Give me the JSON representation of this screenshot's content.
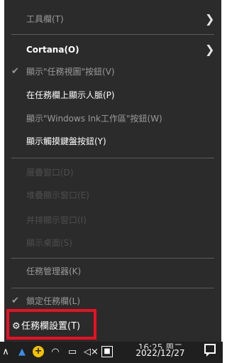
{
  "context_menu": {
    "items": [
      {
        "label": "工具欄(T)",
        "state": "muted",
        "submenu": true,
        "checked": false
      },
      {
        "label": "Cortana(O)",
        "state": "bold",
        "submenu": true,
        "checked": false
      },
      {
        "label": "顯示\"任務視圖\"按鈕(V)",
        "state": "muted",
        "submenu": false,
        "checked": true
      },
      {
        "label": "在任務欄上顯示人脈(P)",
        "state": "normal",
        "submenu": false,
        "checked": false
      },
      {
        "label": "顯示\"Windows Ink工作區\"按鈕(W)",
        "state": "muted",
        "submenu": false,
        "checked": false
      },
      {
        "label": "顯示觸摸鍵盤按鈕(Y)",
        "state": "normal",
        "submenu": false,
        "checked": false
      },
      {
        "label": "層疊窗口(D)",
        "state": "disabled",
        "submenu": false,
        "checked": false
      },
      {
        "label": "堆疊顯示窗口(E)",
        "state": "disabled",
        "submenu": false,
        "checked": false
      },
      {
        "label": "并排顯示窗口(I)",
        "state": "disabled",
        "submenu": false,
        "checked": false
      },
      {
        "label": "顯示桌面(S)",
        "state": "disabled",
        "submenu": false,
        "checked": false
      },
      {
        "label": "任務管理器(K)",
        "state": "muted",
        "submenu": false,
        "checked": false
      },
      {
        "label": "鎖定任務欄(L)",
        "state": "muted",
        "submenu": false,
        "checked": true
      },
      {
        "label": "任務欄設置(T)",
        "state": "normal",
        "submenu": false,
        "checked": false,
        "icon": "gear-icon",
        "highlighted": true
      }
    ],
    "highlight_color": "#e81123"
  },
  "taskbar": {
    "date": "2022/12/27",
    "time": "16:25 周二",
    "tray_icons": [
      "chevron-up-icon",
      "bluetooth-icon",
      "plus-badge-icon",
      "wifi-icon",
      "battery-icon",
      "volume-muted-icon",
      "app-badge-icon",
      "notification-icon"
    ]
  }
}
